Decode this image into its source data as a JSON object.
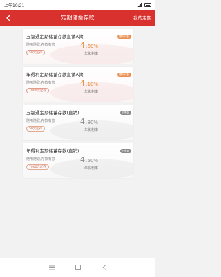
{
  "status": {
    "time": "上午10:21"
  },
  "header": {
    "title": "定期储蓄存款",
    "right_link": "我的定期"
  },
  "products": [
    {
      "name": "五福通定期储蓄存款直销A款",
      "desc": "随用随取,存款有息",
      "min": "50元起存",
      "rate_int": "4.",
      "rate_dec": "60%",
      "rate_label": "年化利率",
      "badge": "限时代售"
    },
    {
      "name": "年得利定期储蓄存款直销A款",
      "desc": "随用随取,存款有息",
      "min": "1000元起存",
      "rate_int": "4.",
      "rate_dec": "10%",
      "rate_label": "年化利率",
      "badge": "限时代售"
    },
    {
      "name": "五福通定期储蓄存款(直销)",
      "desc": "随用随取,存款有息",
      "min": "50元起存",
      "rate_int": "4.",
      "rate_dec": "80%",
      "rate_label": "年化利率",
      "badge": "已售罄"
    },
    {
      "name": "年得利定期储蓄存款(直销)",
      "desc": "随用随取,存款有息",
      "min": "7000元起存",
      "rate_int": "4.",
      "rate_dec": "50%",
      "rate_label": "年化利率",
      "badge": "已售罄"
    }
  ],
  "colors": {
    "brand_red": "#d8312e",
    "accent_orange": "#e9862f",
    "soldout_grey": "#8a8a8a"
  },
  "icons": {
    "back": "chevron-left-icon",
    "menu": "menu-icon",
    "home": "square-icon",
    "nav_back": "chevron-left-icon"
  }
}
